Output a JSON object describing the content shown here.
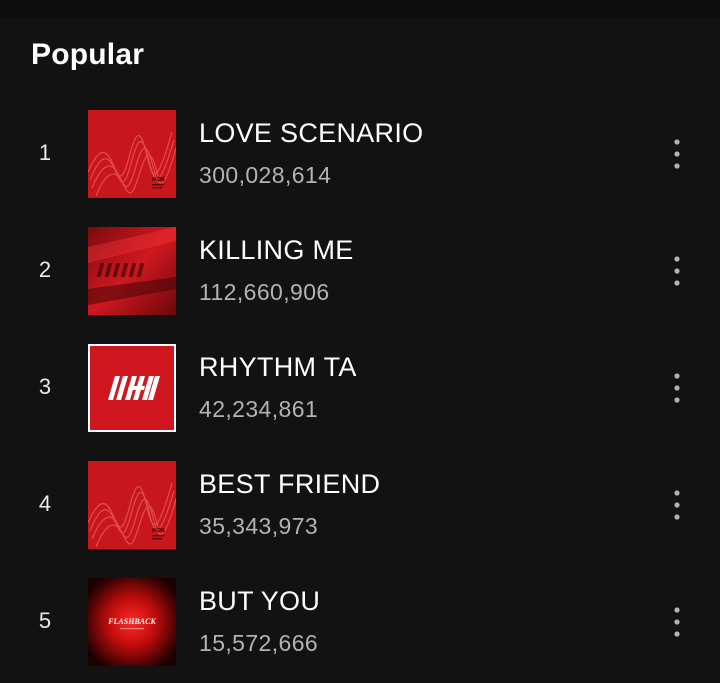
{
  "section": {
    "title": "Popular"
  },
  "tracks": [
    {
      "index": "1",
      "title": "LOVE SCENARIO",
      "plays": "300,028,614",
      "cover_icon": "return-album-cover",
      "cover_label": "iKON"
    },
    {
      "index": "2",
      "title": "KILLING ME",
      "plays": "112,660,906",
      "cover_icon": "new-kids-album-cover"
    },
    {
      "index": "3",
      "title": "RHYTHM TA",
      "plays": "42,234,861",
      "cover_icon": "welcome-back-album-cover"
    },
    {
      "index": "4",
      "title": "BEST FRIEND",
      "plays": "35,343,973",
      "cover_icon": "return-album-cover",
      "cover_label": "iKON"
    },
    {
      "index": "5",
      "title": "BUT YOU",
      "plays": "15,572,666",
      "cover_icon": "flashback-album-cover",
      "cover_label": "FLASHBACK"
    }
  ],
  "colors": {
    "background": "#121212",
    "primary_text": "#ffffff",
    "secondary_text": "#b3b3b3",
    "cover_red": "#c8161d"
  }
}
